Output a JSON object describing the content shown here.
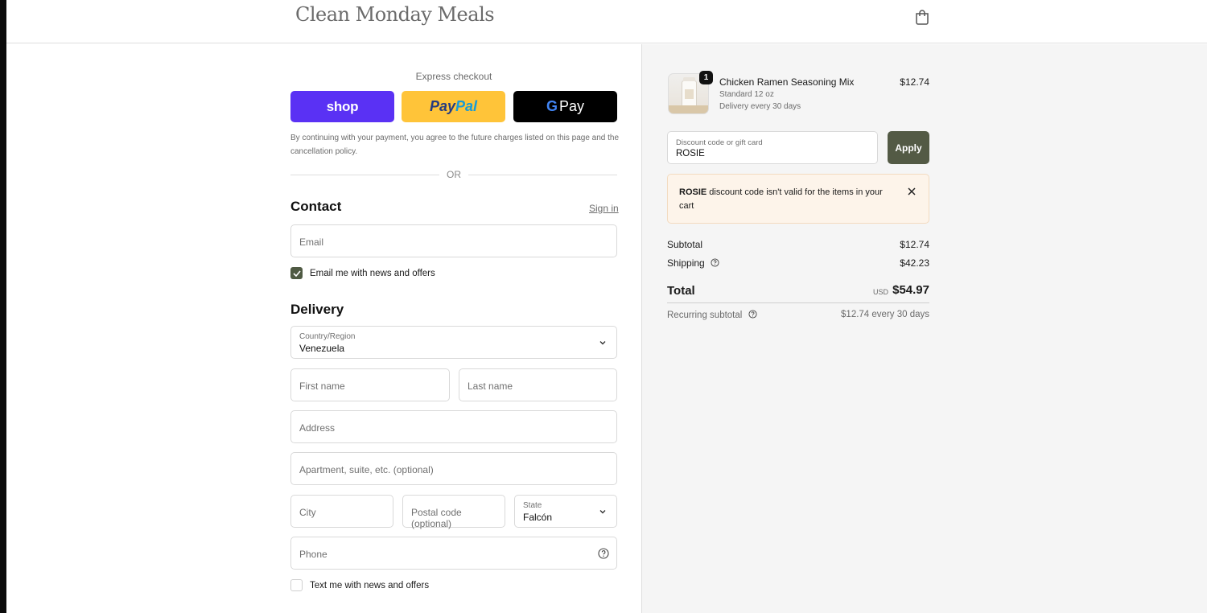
{
  "brand": {
    "logo_text": "Clean Monday Meals"
  },
  "express": {
    "title": "Express checkout",
    "shop_label": "shop",
    "paypal_label_a": "Pay",
    "paypal_label_b": "Pal",
    "gpay_g": "G",
    "gpay_label": "Pay",
    "terms": "By continuing with your payment, you agree to the future charges listed on this page and the cancellation policy.",
    "or_text": "OR"
  },
  "contact": {
    "title": "Contact",
    "signin_label": "Sign in",
    "email_placeholder": "Email",
    "email_optin_label": "Email me with news and offers",
    "email_optin_checked": true
  },
  "delivery": {
    "title": "Delivery",
    "country_label": "Country/Region",
    "country_value": "Venezuela",
    "first_name_placeholder": "First name",
    "last_name_placeholder": "Last name",
    "address_placeholder": "Address",
    "apartment_placeholder": "Apartment, suite, etc. (optional)",
    "city_placeholder": "City",
    "postal_placeholder": "Postal code (optional)",
    "state_label": "State",
    "state_value": "Falcón",
    "phone_placeholder": "Phone",
    "text_optin_label": "Text me with news and offers",
    "text_optin_checked": false
  },
  "order": {
    "item": {
      "quantity": "1",
      "name": "Chicken Ramen Seasoning Mix",
      "variant": "Standard 12 oz",
      "delivery": "Delivery every 30 days",
      "price": "$12.74"
    },
    "discount": {
      "label": "Discount code or gift card",
      "value": "ROSIE",
      "apply_label": "Apply"
    },
    "alert": {
      "code": "ROSIE",
      "message": " discount code isn't valid for the items in your cart"
    },
    "subtotal_label": "Subtotal",
    "subtotal_value": "$12.74",
    "shipping_label": "Shipping",
    "shipping_value": "$42.23",
    "total_label": "Total",
    "total_currency": "USD",
    "total_value": "$54.97",
    "recurring_label": "Recurring subtotal",
    "recurring_value": "$12.74 every 30 days"
  },
  "colors": {
    "shop_pay": "#5a31f4",
    "paypal": "#ffc439",
    "gpay": "#000000",
    "accent": "#535a45",
    "alert_bg": "#fdf4ea"
  }
}
